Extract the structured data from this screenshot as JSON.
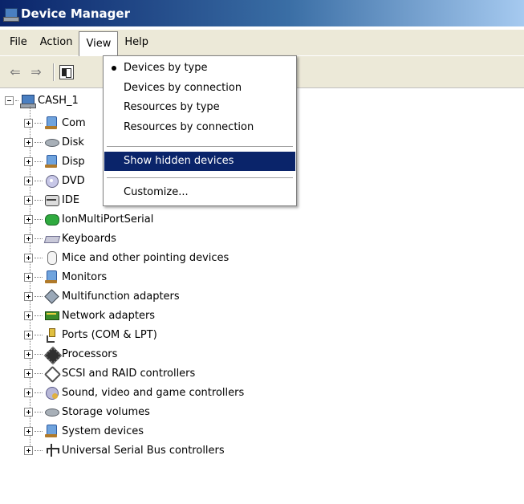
{
  "window": {
    "title": "Device Manager",
    "icon": "computer-icon"
  },
  "menubar": {
    "items": [
      {
        "label": "File"
      },
      {
        "label": "Action"
      },
      {
        "label": "View",
        "open": true
      },
      {
        "label": "Help"
      }
    ]
  },
  "toolbar": {
    "back_icon": "back-arrow-icon",
    "forward_icon": "forward-arrow-icon",
    "pane_icon": "show-hide-console-tree-icon"
  },
  "tree": {
    "root": {
      "label": "CASH_1",
      "icon": "computer-icon"
    },
    "items": [
      {
        "label": "Com",
        "icon": "computer-node-icon"
      },
      {
        "label": "Disk",
        "icon": "disk-drive-icon"
      },
      {
        "label": "Disp",
        "icon": "display-adapter-icon"
      },
      {
        "label": "DVD",
        "icon": "dvd-drive-icon"
      },
      {
        "label": "IDE",
        "icon": "ide-controller-icon"
      },
      {
        "label": "IonMultiPortSerial",
        "icon": "multiport-serial-icon"
      },
      {
        "label": "Keyboards",
        "icon": "keyboard-icon"
      },
      {
        "label": "Mice and other pointing devices",
        "icon": "mouse-icon"
      },
      {
        "label": "Monitors",
        "icon": "monitor-icon"
      },
      {
        "label": "Multifunction adapters",
        "icon": "multifunction-adapter-icon"
      },
      {
        "label": "Network adapters",
        "icon": "network-adapter-icon"
      },
      {
        "label": "Ports (COM & LPT)",
        "icon": "port-icon"
      },
      {
        "label": "Processors",
        "icon": "processor-icon"
      },
      {
        "label": "SCSI and RAID controllers",
        "icon": "scsi-controller-icon"
      },
      {
        "label": "Sound, video and game controllers",
        "icon": "sound-icon"
      },
      {
        "label": "Storage volumes",
        "icon": "storage-volume-icon"
      },
      {
        "label": "System devices",
        "icon": "system-device-icon"
      },
      {
        "label": "Universal Serial Bus controllers",
        "icon": "usb-icon"
      }
    ]
  },
  "view_menu": {
    "items": [
      {
        "label": "Devices by type",
        "checked": true
      },
      {
        "label": "Devices by connection"
      },
      {
        "label": "Resources by type"
      },
      {
        "label": "Resources by connection"
      },
      {
        "label": "Show hidden devices",
        "highlighted": true
      },
      {
        "label": "Customize..."
      }
    ]
  },
  "colors": {
    "title_bar": "#0a246a",
    "menu_highlight": "#0a246a",
    "chrome": "#ece9d8"
  }
}
